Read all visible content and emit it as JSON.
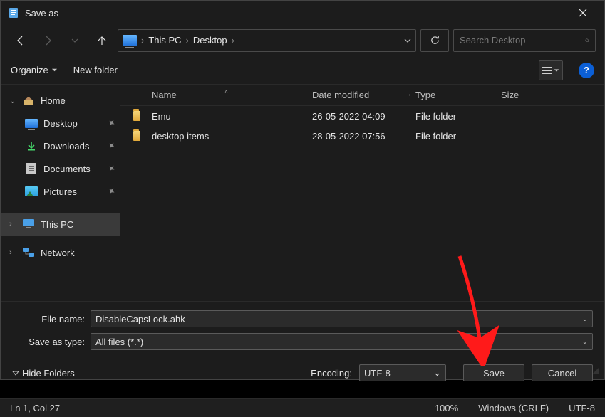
{
  "title": "Save as",
  "breadcrumb": {
    "root": "This PC",
    "current": "Desktop"
  },
  "search": {
    "placeholder": "Search Desktop"
  },
  "toolbar": {
    "organize": "Organize",
    "newfolder": "New folder"
  },
  "sidebar": {
    "home": "Home",
    "desktop": "Desktop",
    "downloads": "Downloads",
    "documents": "Documents",
    "pictures": "Pictures",
    "thispc": "This PC",
    "network": "Network"
  },
  "columns": {
    "name": "Name",
    "date": "Date modified",
    "type": "Type",
    "size": "Size"
  },
  "rows": [
    {
      "name": "Emu",
      "date": "26-05-2022 04:09",
      "type": "File folder"
    },
    {
      "name": "desktop items",
      "date": "28-05-2022 07:56",
      "type": "File folder"
    }
  ],
  "form": {
    "filename_label": "File name:",
    "filename_value": "DisableCapsLock.ahk",
    "type_label": "Save as type:",
    "type_value": "All files  (*.*)"
  },
  "actions": {
    "hide": "Hide Folders",
    "encoding_label": "Encoding:",
    "encoding_value": "UTF-8",
    "save": "Save",
    "cancel": "Cancel"
  },
  "status": {
    "pos": "Ln 1, Col 27",
    "zoom": "100%",
    "eol": "Windows (CRLF)",
    "enc": "UTF-8"
  },
  "help_glyph": "?"
}
